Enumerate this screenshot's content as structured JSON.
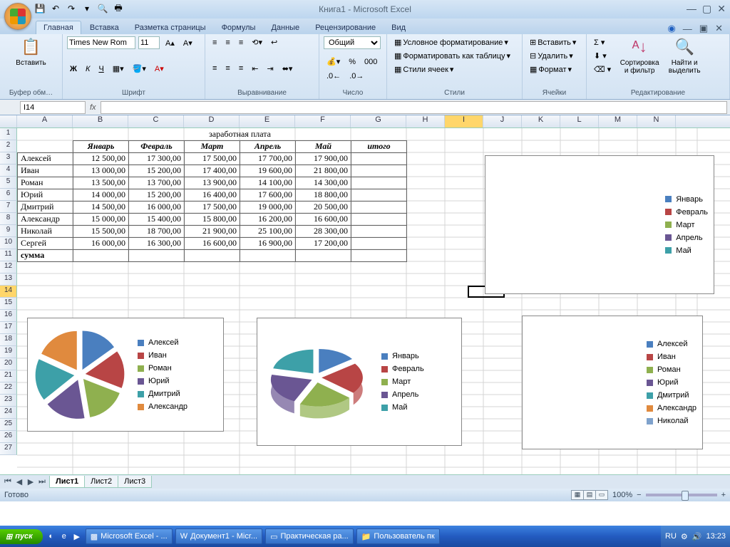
{
  "window": {
    "title": "Книга1 - Microsoft Excel"
  },
  "tabs": [
    "Главная",
    "Вставка",
    "Разметка страницы",
    "Формулы",
    "Данные",
    "Рецензирование",
    "Вид"
  ],
  "ribbon": {
    "clipboard": {
      "paste": "Вставить",
      "title": "Буфер обм…"
    },
    "font": {
      "family": "Times New Rom",
      "size": "11",
      "title": "Шрифт",
      "bold": "Ж",
      "italic": "К",
      "underline": "Ч"
    },
    "align": {
      "title": "Выравнивание"
    },
    "number": {
      "format": "Общий",
      "title": "Число"
    },
    "styles": {
      "cond": "Условное форматирование",
      "table": "Форматировать как таблицу",
      "cells": "Стили ячеек",
      "title": "Стили"
    },
    "cells2": {
      "insert": "Вставить",
      "delete": "Удалить",
      "format": "Формат",
      "title": "Ячейки"
    },
    "editing": {
      "sort": "Сортировка и фильтр",
      "find": "Найти и выделить",
      "title": "Редактирование"
    }
  },
  "namebox": "I14",
  "sheet_title": "заработная плата",
  "columns": [
    "Январь",
    "Февраль",
    "Март",
    "Апрель",
    "Май",
    "итого"
  ],
  "row_names": [
    "Алексей",
    "Иван",
    "Роман",
    "Юрий",
    "Дмитрий",
    "Александр",
    "Николай",
    "Сергей"
  ],
  "sum_label": "сумма",
  "values": [
    [
      "12 500,00",
      "17 300,00",
      "17 500,00",
      "17 700,00",
      "17 900,00"
    ],
    [
      "13 000,00",
      "15 200,00",
      "17 400,00",
      "19 600,00",
      "21 800,00"
    ],
    [
      "13 500,00",
      "13 700,00",
      "13 900,00",
      "14 100,00",
      "14 300,00"
    ],
    [
      "14 000,00",
      "15 200,00",
      "16 400,00",
      "17 600,00",
      "18 800,00"
    ],
    [
      "14 500,00",
      "16 000,00",
      "17 500,00",
      "19 000,00",
      "20 500,00"
    ],
    [
      "15 000,00",
      "15 400,00",
      "15 800,00",
      "16 200,00",
      "16 600,00"
    ],
    [
      "15 500,00",
      "18 700,00",
      "21 900,00",
      "25 100,00",
      "28 300,00"
    ],
    [
      "16 000,00",
      "16 300,00",
      "16 600,00",
      "16 900,00",
      "17 200,00"
    ]
  ],
  "chart_data": [
    {
      "type": "pie",
      "categories": [
        "Алексей",
        "Иван",
        "Роман",
        "Юрий",
        "Дмитрий",
        "Александр"
      ],
      "values": [
        12500,
        13000,
        13500,
        14000,
        14500,
        15000
      ],
      "colors": [
        "#4a7fbf",
        "#b84545",
        "#8fb04f",
        "#6a5693",
        "#3da0a8",
        "#e08a3e"
      ]
    },
    {
      "type": "pie",
      "categories": [
        "Январь",
        "Февраль",
        "Март",
        "Апрель",
        "Май"
      ],
      "values": [
        12500,
        17300,
        17500,
        17700,
        17900
      ],
      "colors": [
        "#4a7fbf",
        "#b84545",
        "#8fb04f",
        "#6a5693",
        "#3da0a8"
      ],
      "style": "3d"
    },
    {
      "type": "bar",
      "categories": [
        "Январь",
        "Февраль",
        "Март",
        "Апрель",
        "Май"
      ],
      "series": [],
      "colors": [
        "#4a7fbf",
        "#b84545",
        "#8fb04f",
        "#6a5693",
        "#3da0a8"
      ],
      "note": "legend-only placeholder (plot area empty)"
    },
    {
      "type": "bar",
      "categories": [
        "Алексей",
        "Иван",
        "Роман",
        "Юрий",
        "Дмитрий",
        "Александр",
        "Николай"
      ],
      "series": [],
      "colors": [
        "#4a7fbf",
        "#b84545",
        "#8fb04f",
        "#6a5693",
        "#3da0a8",
        "#e08a3e",
        "#7fa2cc"
      ],
      "note": "legend-only placeholder (plot area empty)"
    }
  ],
  "sheets": [
    "Лист1",
    "Лист2",
    "Лист3"
  ],
  "status": {
    "ready": "Готово",
    "zoom": "100%"
  },
  "taskbar": {
    "start": "пуск",
    "items": [
      "Microsoft Excel - ...",
      "Документ1 - Micr...",
      "Практическая ра...",
      "Пользователь пк"
    ],
    "lang": "RU",
    "time": "13:23"
  },
  "col_letters": [
    "",
    "A",
    "B",
    "C",
    "D",
    "E",
    "F",
    "G",
    "H",
    "I",
    "J",
    "K",
    "L",
    "M",
    "N"
  ]
}
